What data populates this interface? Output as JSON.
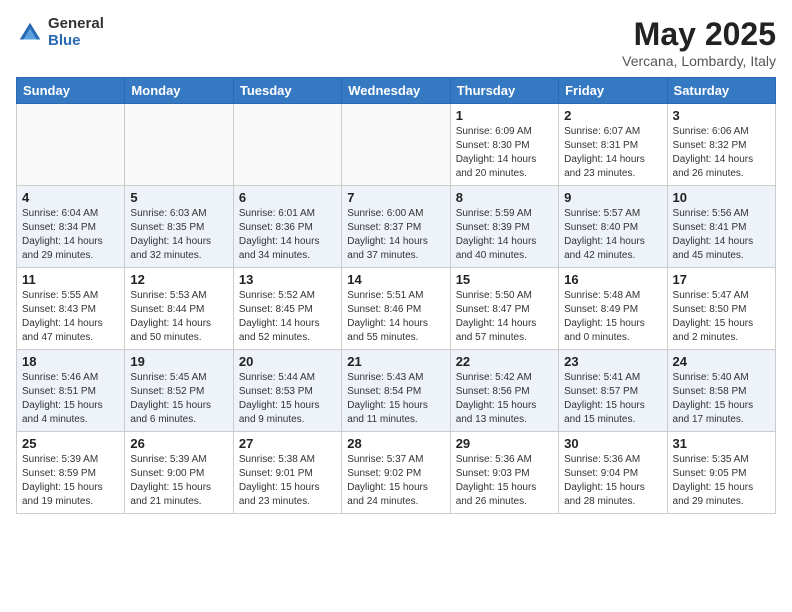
{
  "logo": {
    "general": "General",
    "blue": "Blue"
  },
  "title": "May 2025",
  "location": "Vercana, Lombardy, Italy",
  "days_of_week": [
    "Sunday",
    "Monday",
    "Tuesday",
    "Wednesday",
    "Thursday",
    "Friday",
    "Saturday"
  ],
  "weeks": [
    [
      {
        "day": "",
        "info": ""
      },
      {
        "day": "",
        "info": ""
      },
      {
        "day": "",
        "info": ""
      },
      {
        "day": "",
        "info": ""
      },
      {
        "day": "1",
        "info": "Sunrise: 6:09 AM\nSunset: 8:30 PM\nDaylight: 14 hours\nand 20 minutes."
      },
      {
        "day": "2",
        "info": "Sunrise: 6:07 AM\nSunset: 8:31 PM\nDaylight: 14 hours\nand 23 minutes."
      },
      {
        "day": "3",
        "info": "Sunrise: 6:06 AM\nSunset: 8:32 PM\nDaylight: 14 hours\nand 26 minutes."
      }
    ],
    [
      {
        "day": "4",
        "info": "Sunrise: 6:04 AM\nSunset: 8:34 PM\nDaylight: 14 hours\nand 29 minutes."
      },
      {
        "day": "5",
        "info": "Sunrise: 6:03 AM\nSunset: 8:35 PM\nDaylight: 14 hours\nand 32 minutes."
      },
      {
        "day": "6",
        "info": "Sunrise: 6:01 AM\nSunset: 8:36 PM\nDaylight: 14 hours\nand 34 minutes."
      },
      {
        "day": "7",
        "info": "Sunrise: 6:00 AM\nSunset: 8:37 PM\nDaylight: 14 hours\nand 37 minutes."
      },
      {
        "day": "8",
        "info": "Sunrise: 5:59 AM\nSunset: 8:39 PM\nDaylight: 14 hours\nand 40 minutes."
      },
      {
        "day": "9",
        "info": "Sunrise: 5:57 AM\nSunset: 8:40 PM\nDaylight: 14 hours\nand 42 minutes."
      },
      {
        "day": "10",
        "info": "Sunrise: 5:56 AM\nSunset: 8:41 PM\nDaylight: 14 hours\nand 45 minutes."
      }
    ],
    [
      {
        "day": "11",
        "info": "Sunrise: 5:55 AM\nSunset: 8:43 PM\nDaylight: 14 hours\nand 47 minutes."
      },
      {
        "day": "12",
        "info": "Sunrise: 5:53 AM\nSunset: 8:44 PM\nDaylight: 14 hours\nand 50 minutes."
      },
      {
        "day": "13",
        "info": "Sunrise: 5:52 AM\nSunset: 8:45 PM\nDaylight: 14 hours\nand 52 minutes."
      },
      {
        "day": "14",
        "info": "Sunrise: 5:51 AM\nSunset: 8:46 PM\nDaylight: 14 hours\nand 55 minutes."
      },
      {
        "day": "15",
        "info": "Sunrise: 5:50 AM\nSunset: 8:47 PM\nDaylight: 14 hours\nand 57 minutes."
      },
      {
        "day": "16",
        "info": "Sunrise: 5:48 AM\nSunset: 8:49 PM\nDaylight: 15 hours\nand 0 minutes."
      },
      {
        "day": "17",
        "info": "Sunrise: 5:47 AM\nSunset: 8:50 PM\nDaylight: 15 hours\nand 2 minutes."
      }
    ],
    [
      {
        "day": "18",
        "info": "Sunrise: 5:46 AM\nSunset: 8:51 PM\nDaylight: 15 hours\nand 4 minutes."
      },
      {
        "day": "19",
        "info": "Sunrise: 5:45 AM\nSunset: 8:52 PM\nDaylight: 15 hours\nand 6 minutes."
      },
      {
        "day": "20",
        "info": "Sunrise: 5:44 AM\nSunset: 8:53 PM\nDaylight: 15 hours\nand 9 minutes."
      },
      {
        "day": "21",
        "info": "Sunrise: 5:43 AM\nSunset: 8:54 PM\nDaylight: 15 hours\nand 11 minutes."
      },
      {
        "day": "22",
        "info": "Sunrise: 5:42 AM\nSunset: 8:56 PM\nDaylight: 15 hours\nand 13 minutes."
      },
      {
        "day": "23",
        "info": "Sunrise: 5:41 AM\nSunset: 8:57 PM\nDaylight: 15 hours\nand 15 minutes."
      },
      {
        "day": "24",
        "info": "Sunrise: 5:40 AM\nSunset: 8:58 PM\nDaylight: 15 hours\nand 17 minutes."
      }
    ],
    [
      {
        "day": "25",
        "info": "Sunrise: 5:39 AM\nSunset: 8:59 PM\nDaylight: 15 hours\nand 19 minutes."
      },
      {
        "day": "26",
        "info": "Sunrise: 5:39 AM\nSunset: 9:00 PM\nDaylight: 15 hours\nand 21 minutes."
      },
      {
        "day": "27",
        "info": "Sunrise: 5:38 AM\nSunset: 9:01 PM\nDaylight: 15 hours\nand 23 minutes."
      },
      {
        "day": "28",
        "info": "Sunrise: 5:37 AM\nSunset: 9:02 PM\nDaylight: 15 hours\nand 24 minutes."
      },
      {
        "day": "29",
        "info": "Sunrise: 5:36 AM\nSunset: 9:03 PM\nDaylight: 15 hours\nand 26 minutes."
      },
      {
        "day": "30",
        "info": "Sunrise: 5:36 AM\nSunset: 9:04 PM\nDaylight: 15 hours\nand 28 minutes."
      },
      {
        "day": "31",
        "info": "Sunrise: 5:35 AM\nSunset: 9:05 PM\nDaylight: 15 hours\nand 29 minutes."
      }
    ]
  ]
}
